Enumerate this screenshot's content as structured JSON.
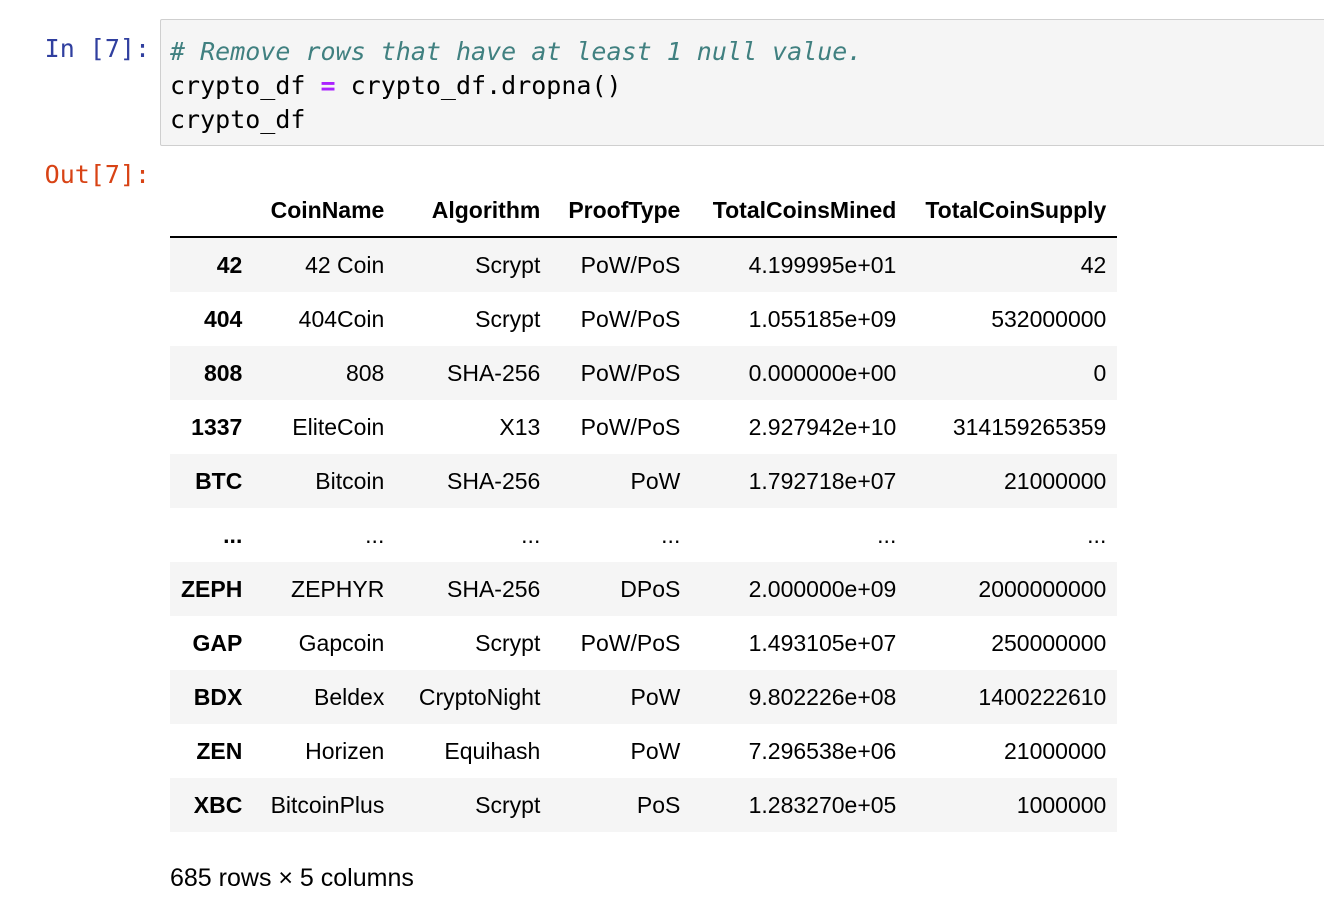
{
  "input_prompt": "In [7]:",
  "output_prompt": "Out[7]:",
  "code": {
    "comment": "# Remove rows that have at least 1 null value.",
    "line2_lhs": "crypto_df ",
    "line2_op": "=",
    "line2_rhs": " crypto_df.dropna()",
    "line3": "crypto_df"
  },
  "dataframe": {
    "columns": [
      "CoinName",
      "Algorithm",
      "ProofType",
      "TotalCoinsMined",
      "TotalCoinSupply"
    ],
    "rows": [
      {
        "index": "42",
        "cells": [
          "42 Coin",
          "Scrypt",
          "PoW/PoS",
          "4.199995e+01",
          "42"
        ]
      },
      {
        "index": "404",
        "cells": [
          "404Coin",
          "Scrypt",
          "PoW/PoS",
          "1.055185e+09",
          "532000000"
        ]
      },
      {
        "index": "808",
        "cells": [
          "808",
          "SHA-256",
          "PoW/PoS",
          "0.000000e+00",
          "0"
        ]
      },
      {
        "index": "1337",
        "cells": [
          "EliteCoin",
          "X13",
          "PoW/PoS",
          "2.927942e+10",
          "314159265359"
        ]
      },
      {
        "index": "BTC",
        "cells": [
          "Bitcoin",
          "SHA-256",
          "PoW",
          "1.792718e+07",
          "21000000"
        ]
      },
      {
        "index": "...",
        "cells": [
          "...",
          "...",
          "...",
          "...",
          "..."
        ]
      },
      {
        "index": "ZEPH",
        "cells": [
          "ZEPHYR",
          "SHA-256",
          "DPoS",
          "2.000000e+09",
          "2000000000"
        ]
      },
      {
        "index": "GAP",
        "cells": [
          "Gapcoin",
          "Scrypt",
          "PoW/PoS",
          "1.493105e+07",
          "250000000"
        ]
      },
      {
        "index": "BDX",
        "cells": [
          "Beldex",
          "CryptoNight",
          "PoW",
          "9.802226e+08",
          "1400222610"
        ]
      },
      {
        "index": "ZEN",
        "cells": [
          "Horizen",
          "Equihash",
          "PoW",
          "7.296538e+06",
          "21000000"
        ]
      },
      {
        "index": "XBC",
        "cells": [
          "BitcoinPlus",
          "Scrypt",
          "PoS",
          "1.283270e+05",
          "1000000"
        ]
      }
    ],
    "shape": "685 rows × 5 columns"
  }
}
